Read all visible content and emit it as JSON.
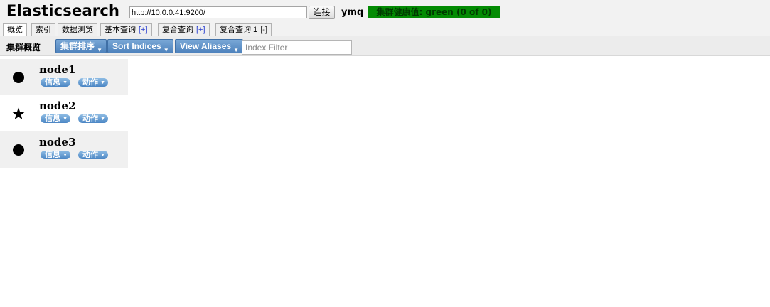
{
  "header": {
    "title": "Elasticsearch",
    "url_value": "http://10.0.0.41:9200/",
    "connect_label": "连接",
    "cluster_name": "ymq",
    "health_text": "集群健康值: green (0 of 0)"
  },
  "tabs": [
    {
      "label": "概览",
      "suffix": ""
    },
    {
      "label": "索引",
      "suffix": ""
    },
    {
      "label": "数据浏览",
      "suffix": ""
    },
    {
      "label": "基本查询",
      "suffix": "[+]"
    },
    {
      "label": "复合查询",
      "suffix": "[+]"
    },
    {
      "label": "复合查询 1",
      "suffix": "[-]"
    }
  ],
  "toolbar": {
    "label": "集群概览",
    "cluster_sort": "集群排序",
    "sort_indices": "Sort Indices",
    "view_aliases": "View Aliases",
    "index_filter_placeholder": "Index Filter"
  },
  "nodes": [
    {
      "name": "node1",
      "icon": "circle-icon",
      "info": "信息",
      "action": "动作"
    },
    {
      "name": "node2",
      "icon": "star-icon",
      "info": "信息",
      "action": "动作"
    },
    {
      "name": "node3",
      "icon": "circle-icon",
      "info": "信息",
      "action": "动作"
    }
  ],
  "colors": {
    "health_green": "#038b03",
    "button_blue": "#4f83bd"
  }
}
